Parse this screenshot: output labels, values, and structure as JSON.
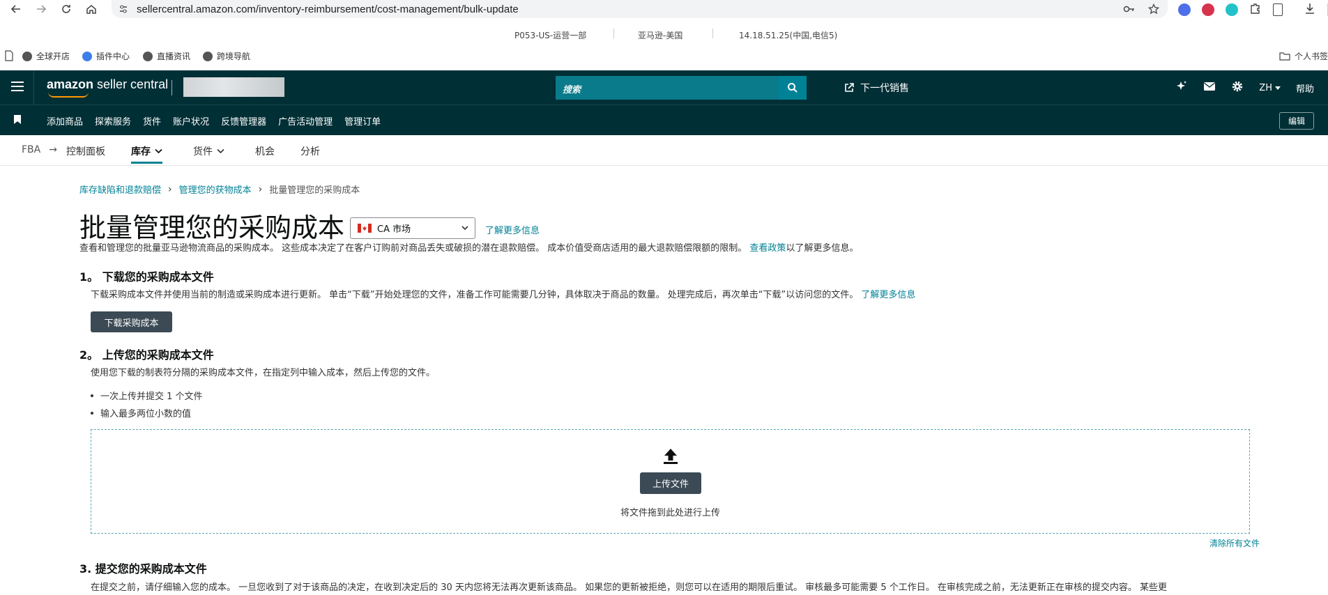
{
  "browser": {
    "url": "sellercentral.amazon.com/inventory-reimbursement/cost-management/bulk-update",
    "info": [
      "P053-US-运营一部",
      "亚马逊-美国",
      "14.18.51.25(中国,电信5)"
    ],
    "bookmarks": [
      "全球开店",
      "插件中心",
      "直播资讯",
      "跨境导航"
    ],
    "bookmarks_right": "个人书签"
  },
  "header": {
    "logo_brand": "amazon",
    "logo_product": "seller central",
    "search_placeholder": "搜索",
    "next_gen": "下一代销售",
    "lang": "ZH",
    "help": "帮助"
  },
  "subnav": {
    "items": [
      "添加商品",
      "探索服务",
      "货件",
      "账户状况",
      "反馈管理器",
      "广告活动管理",
      "管理订单"
    ],
    "edit": "编辑"
  },
  "tabs": {
    "fba": "FBA",
    "items": [
      "控制面板",
      "库存",
      "货件",
      "机会",
      "分析"
    ]
  },
  "breadcrumb": {
    "items": [
      "库存缺陷和退款赔偿",
      "管理您的获物成本"
    ],
    "current": "批量管理您的采购成本"
  },
  "page": {
    "title": "批量管理您的采购成本",
    "market": "CA 市场",
    "learn_more": "了解更多信息",
    "desc": "查看和管理您的批量亚马逊物流商品的采购成本。 这些成本决定了在客户订购前对商品丢失或破损的潜在退款赔偿。 成本价值受商店适用的最大退款赔偿限额的限制。",
    "desc_link": "查看政策",
    "desc_tail": "以了解更多信息。"
  },
  "step1": {
    "title": "1。 下载您的采购成本文件",
    "text": "下载采购成本文件并使用当前的制造或采购成本进行更新。 单击“下载”开始处理您的文件，准备工作可能需要几分钟，具体取决于商品的数量。 处理完成后，再次单击“下载”以访问您的文件。",
    "link": "了解更多信息",
    "button": "下载采购成本"
  },
  "step2": {
    "title": "2。 上传您的采购成本文件",
    "text": "使用您下载的制表符分隔的采购成本文件，在指定列中输入成本，然后上传您的文件。",
    "bullets": [
      "一次上传并提交 1 个文件",
      "输入最多两位小数的值"
    ],
    "upload_button": "上传文件",
    "drop_hint": "将文件拖到此处进行上传",
    "clear_all": "清除所有文件"
  },
  "step3": {
    "title": "3. 提交您的采购成本文件",
    "text": "在提交之前，请仔细输入您的成本。 一旦您收到了对于该商品的决定，在收到决定后的 30 天内您将无法再次更新该商品。 如果您的更新被拒绝，则您可以在适用的期限后重试。 审核最多可能需要 5 个工作日。 在审核完成之前，无法更新正在审核的提交内容。 某些更"
  }
}
